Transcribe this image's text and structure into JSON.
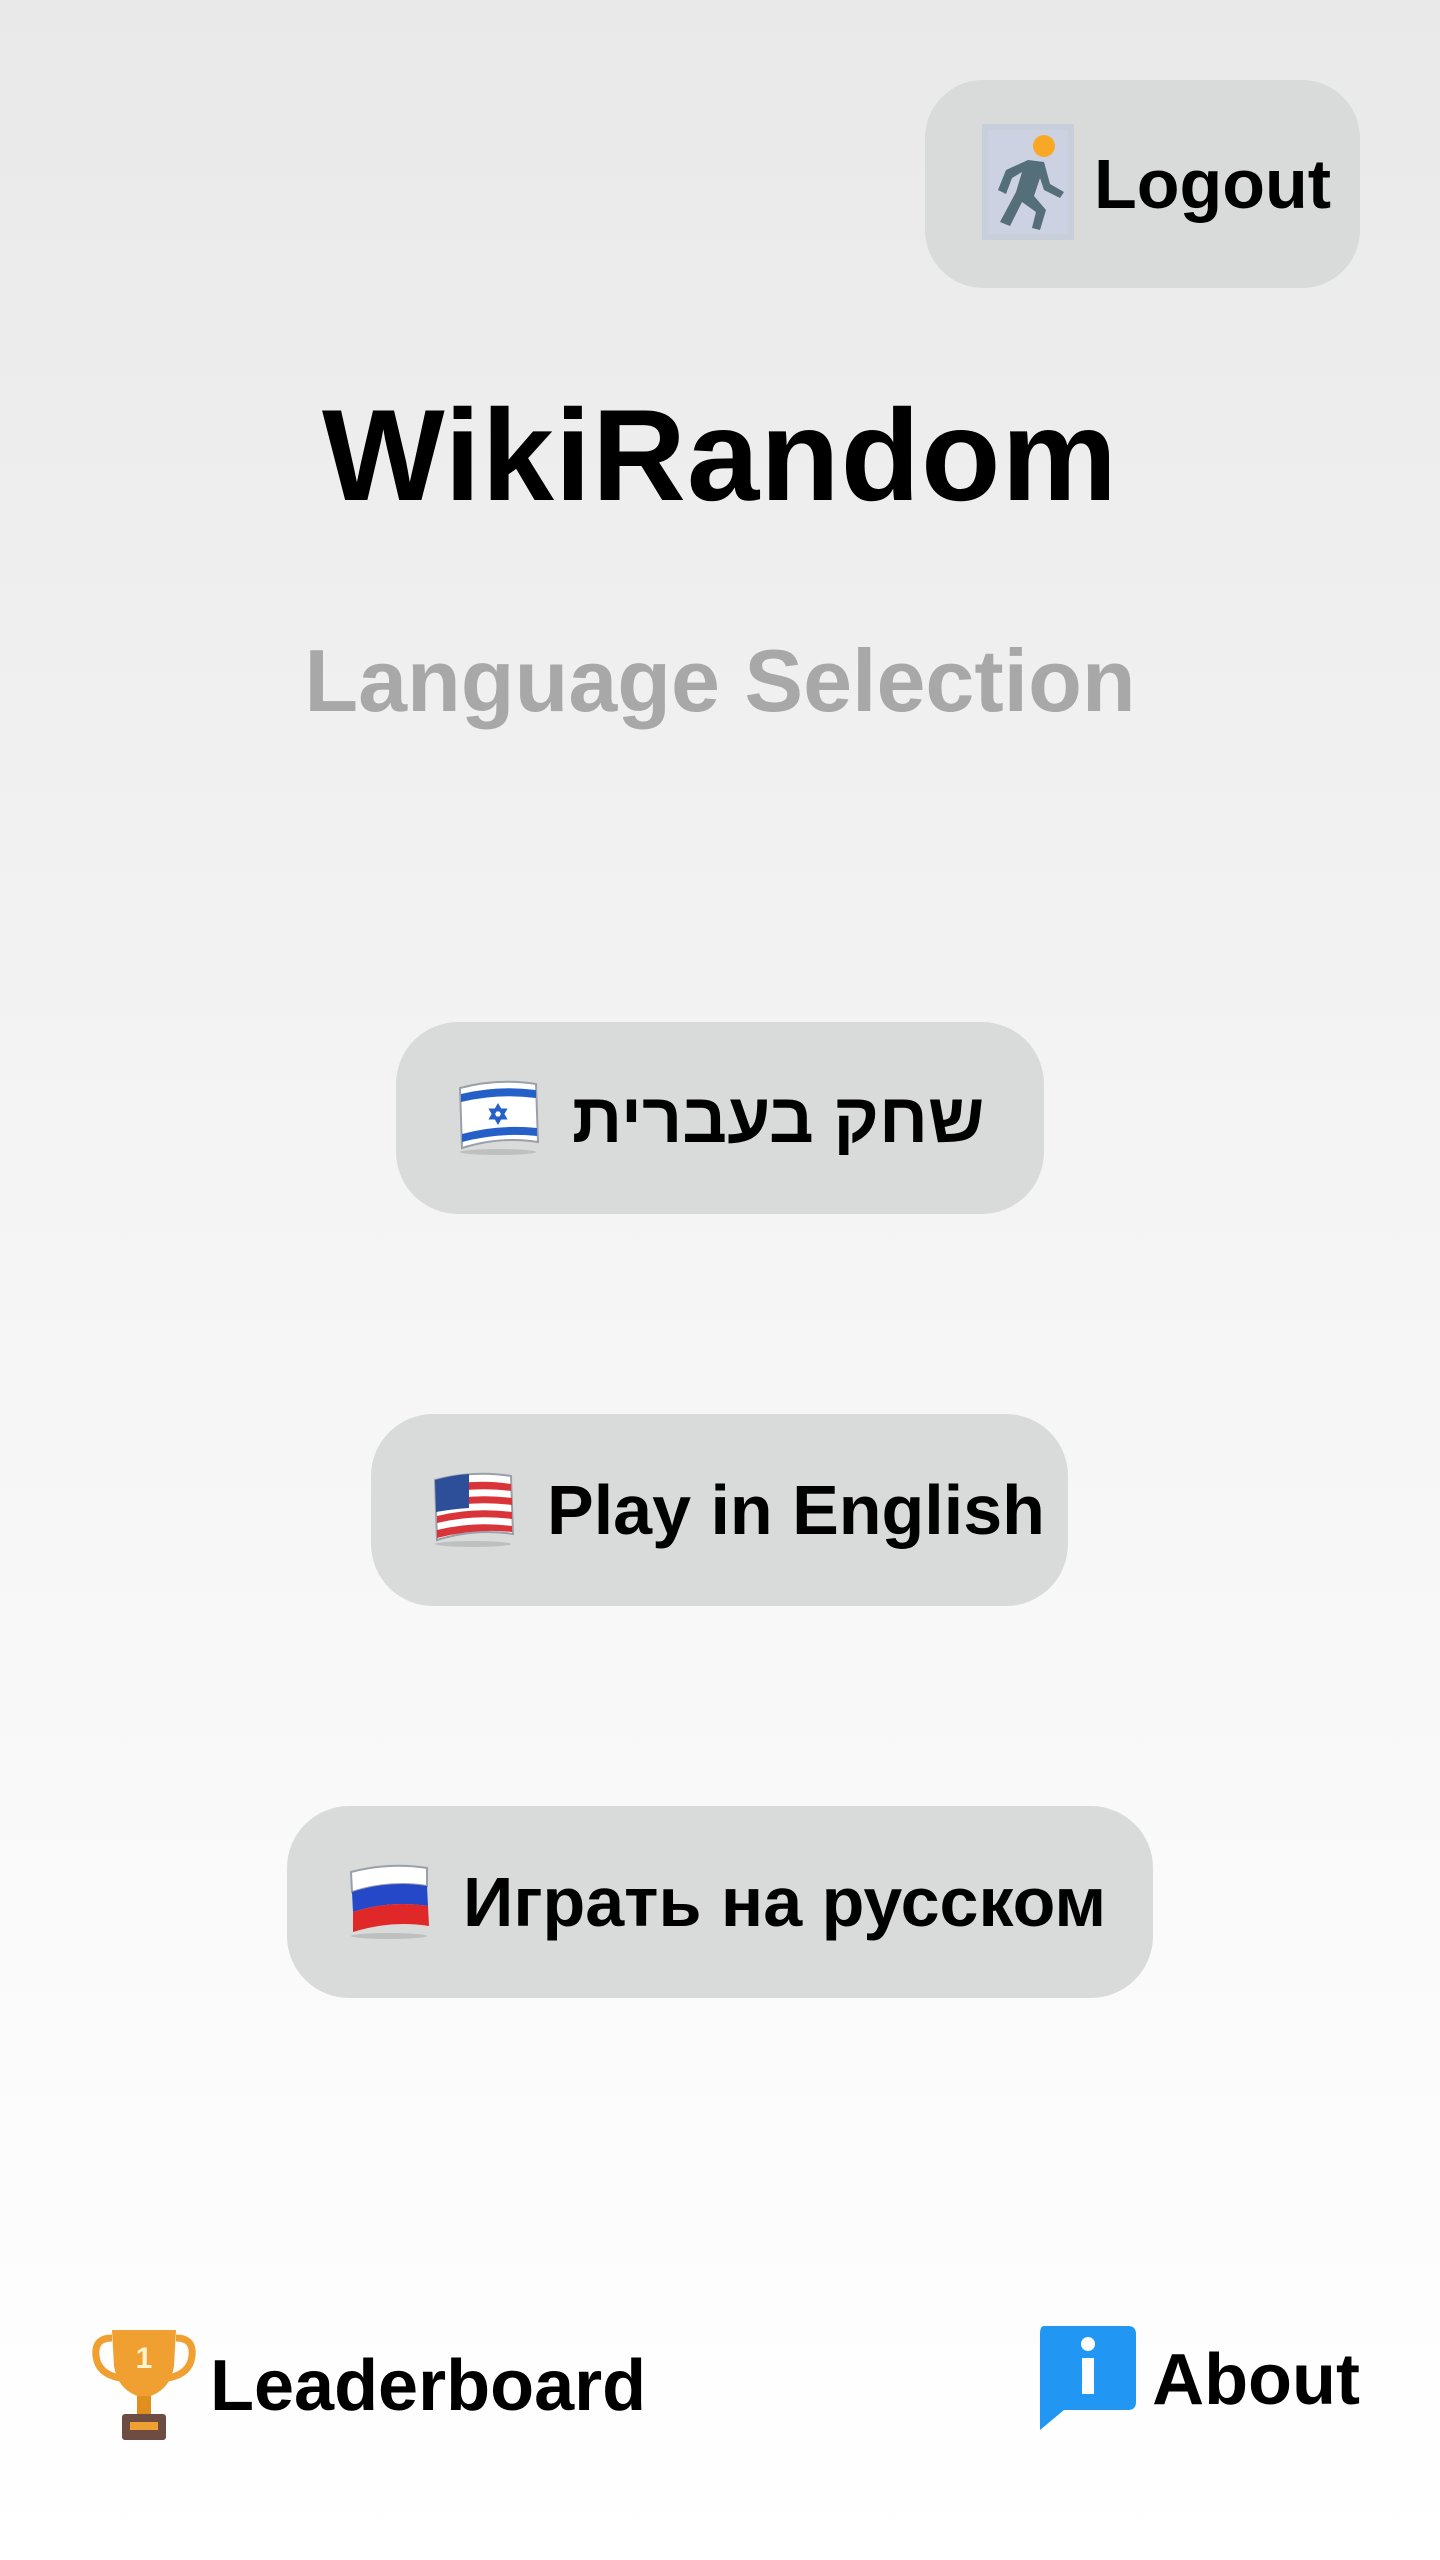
{
  "header": {
    "logout_label": "Logout"
  },
  "app": {
    "title": "WikiRandom",
    "subtitle": "Language Selection"
  },
  "languages": [
    {
      "label": "שחק בעברית",
      "flag": "israel-flag-icon"
    },
    {
      "label": "Play in English",
      "flag": "usa-flag-icon"
    },
    {
      "label": "Играть на русском",
      "flag": "russia-flag-icon"
    }
  ],
  "footer": {
    "leaderboard_label": "Leaderboard",
    "about_label": "About"
  },
  "colors": {
    "button_bg": "#d9dbdb",
    "subtitle": "#a8a8a8",
    "trophy": "#f0a030",
    "about_icon": "#2196f3",
    "logout_icon_figure": "#546e7a",
    "logout_icon_head": "#f9a825"
  }
}
